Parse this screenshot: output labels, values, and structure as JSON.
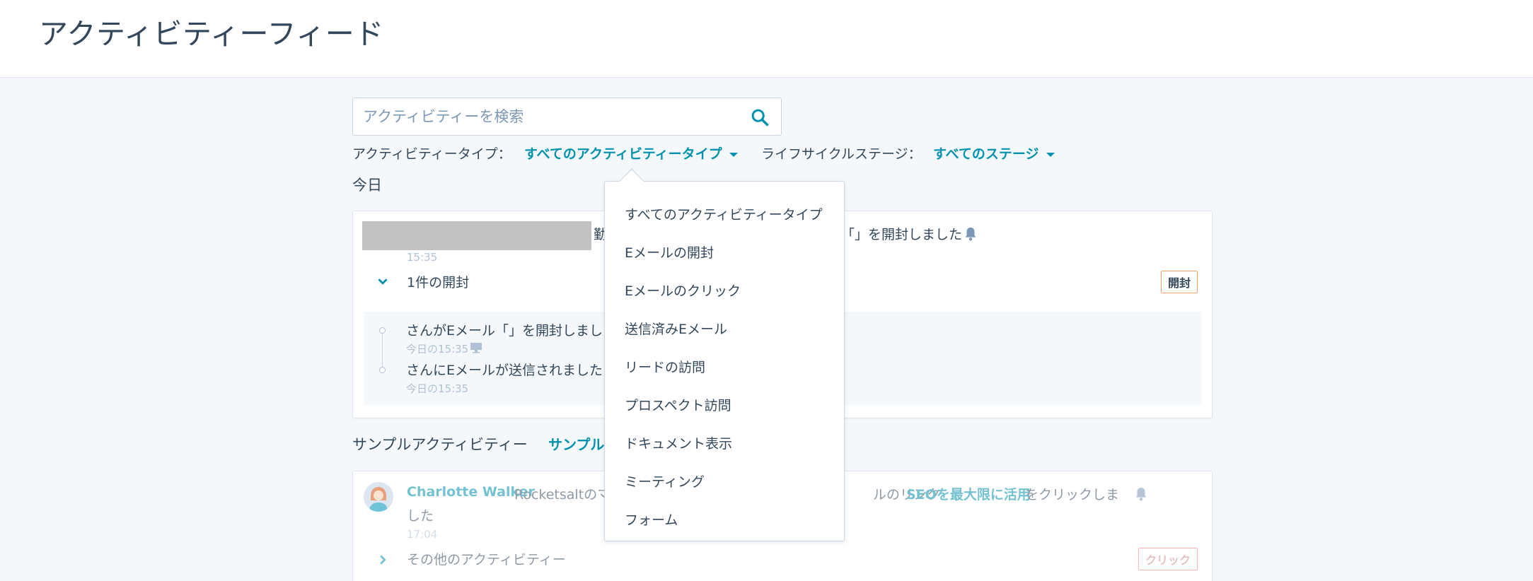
{
  "page": {
    "title": "アクティビティーフィード"
  },
  "search": {
    "placeholder": "アクティビティーを検索"
  },
  "filters": {
    "activity_type_label": "アクティビティータイプ：",
    "activity_type_value": "すべてのアクティビティータイプ",
    "lifecycle_label": "ライフサイクルステージ：",
    "lifecycle_value": "すべてのステージ"
  },
  "today": {
    "heading": "今日",
    "card": {
      "headline_partial": "勤",
      "headline_tail": "「」を開封しました",
      "time": "15:35",
      "summary": "1件の開封",
      "tag": "開封",
      "timeline": [
        {
          "text": "さんがEメール「」を開封しまし",
          "time": "今日の15:35"
        },
        {
          "text": "さんにEメールが送信されました",
          "time": "今日の15:35"
        }
      ]
    }
  },
  "sample": {
    "heading": "サンプルアクティビティー",
    "link_partial": "サンプル",
    "card": {
      "name": "Charlotte Walker",
      "text_before": "Rocketsaltのマ",
      "text_mid": "ルのリンク",
      "link_text": "SEOを最大限に活用",
      "text_after": "をクリックしま",
      "text_wrap": "した",
      "time": "17:04",
      "more": "その他のアクティビティー",
      "tag": "クリック"
    }
  },
  "dropdown": {
    "items": [
      "すべてのアクティビティータイプ",
      "Eメールの開封",
      "Eメールのクリック",
      "送信済みEメール",
      "リードの訪問",
      "プロスペクト訪問",
      "ドキュメント表示",
      "ミーティング",
      "フォーム"
    ]
  },
  "colors": {
    "accent": "#0091ae",
    "text": "#33475b",
    "muted": "#b0c1d4",
    "background": "#f5f8fa",
    "open_tag_border": "#f5a26b",
    "click_tag_border": "#f2545b"
  }
}
